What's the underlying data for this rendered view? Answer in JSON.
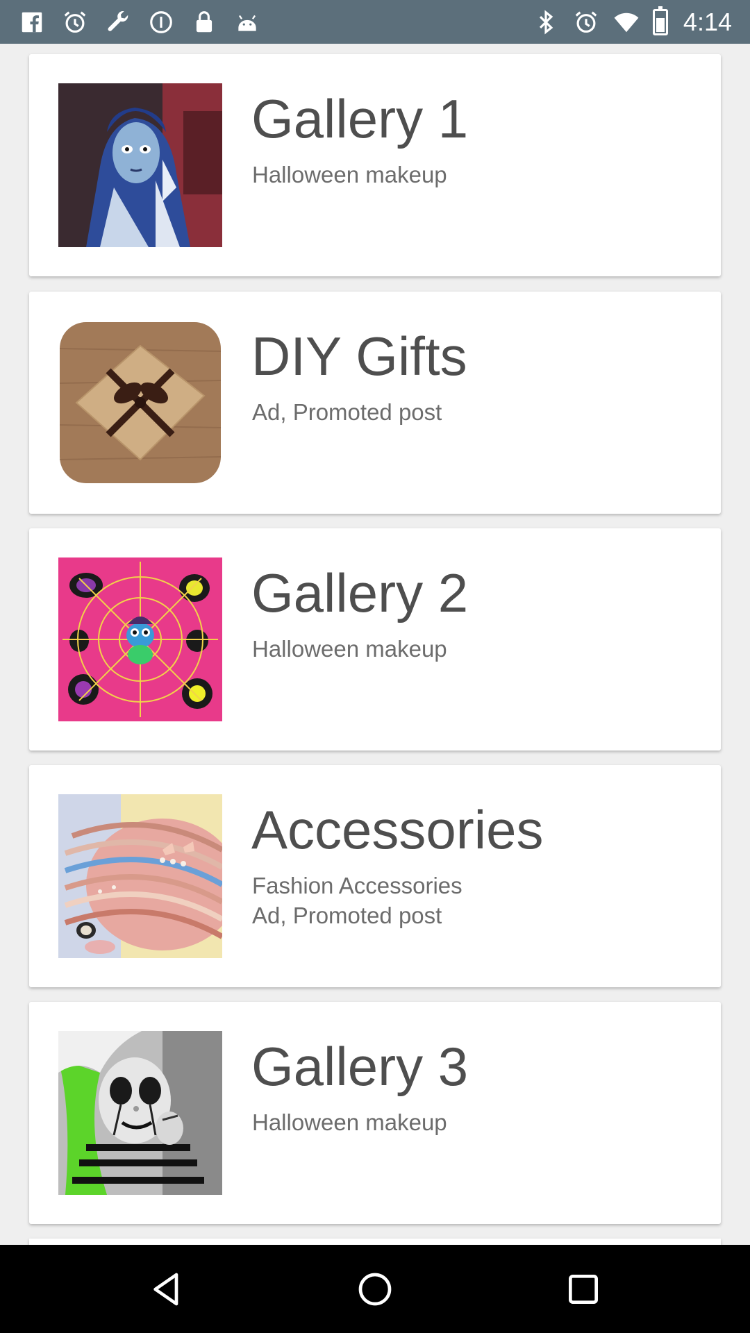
{
  "status_bar": {
    "time": "4:14",
    "left_icons": [
      "facebook-icon",
      "alarm-icon",
      "wrench-icon",
      "info-icon",
      "lock-icon",
      "android-icon"
    ],
    "right_icons": [
      "bluetooth-icon",
      "alarm-icon",
      "wifi-icon",
      "battery-icon"
    ],
    "background": "#5c6f7b"
  },
  "items": [
    {
      "title": "Gallery 1",
      "subtitle": "Halloween makeup",
      "subtitle2": "",
      "thumb": "gothic-bride-photo"
    },
    {
      "title": "DIY Gifts",
      "subtitle": "Ad, Promoted post",
      "subtitle2": "",
      "thumb": "gift-box-photo"
    },
    {
      "title": "Gallery 2",
      "subtitle": "Halloween makeup",
      "subtitle2": "",
      "thumb": "spider-web-art"
    },
    {
      "title": "Accessories",
      "subtitle": "Fashion Accessories",
      "subtitle2": "Ad, Promoted post",
      "thumb": "bracelets-photo"
    },
    {
      "title": "Gallery 3",
      "subtitle": "Halloween makeup",
      "subtitle2": "",
      "thumb": "clown-makeup-photo"
    }
  ],
  "nav_bar": {
    "buttons": [
      "back-icon",
      "home-icon",
      "recents-icon"
    ]
  }
}
